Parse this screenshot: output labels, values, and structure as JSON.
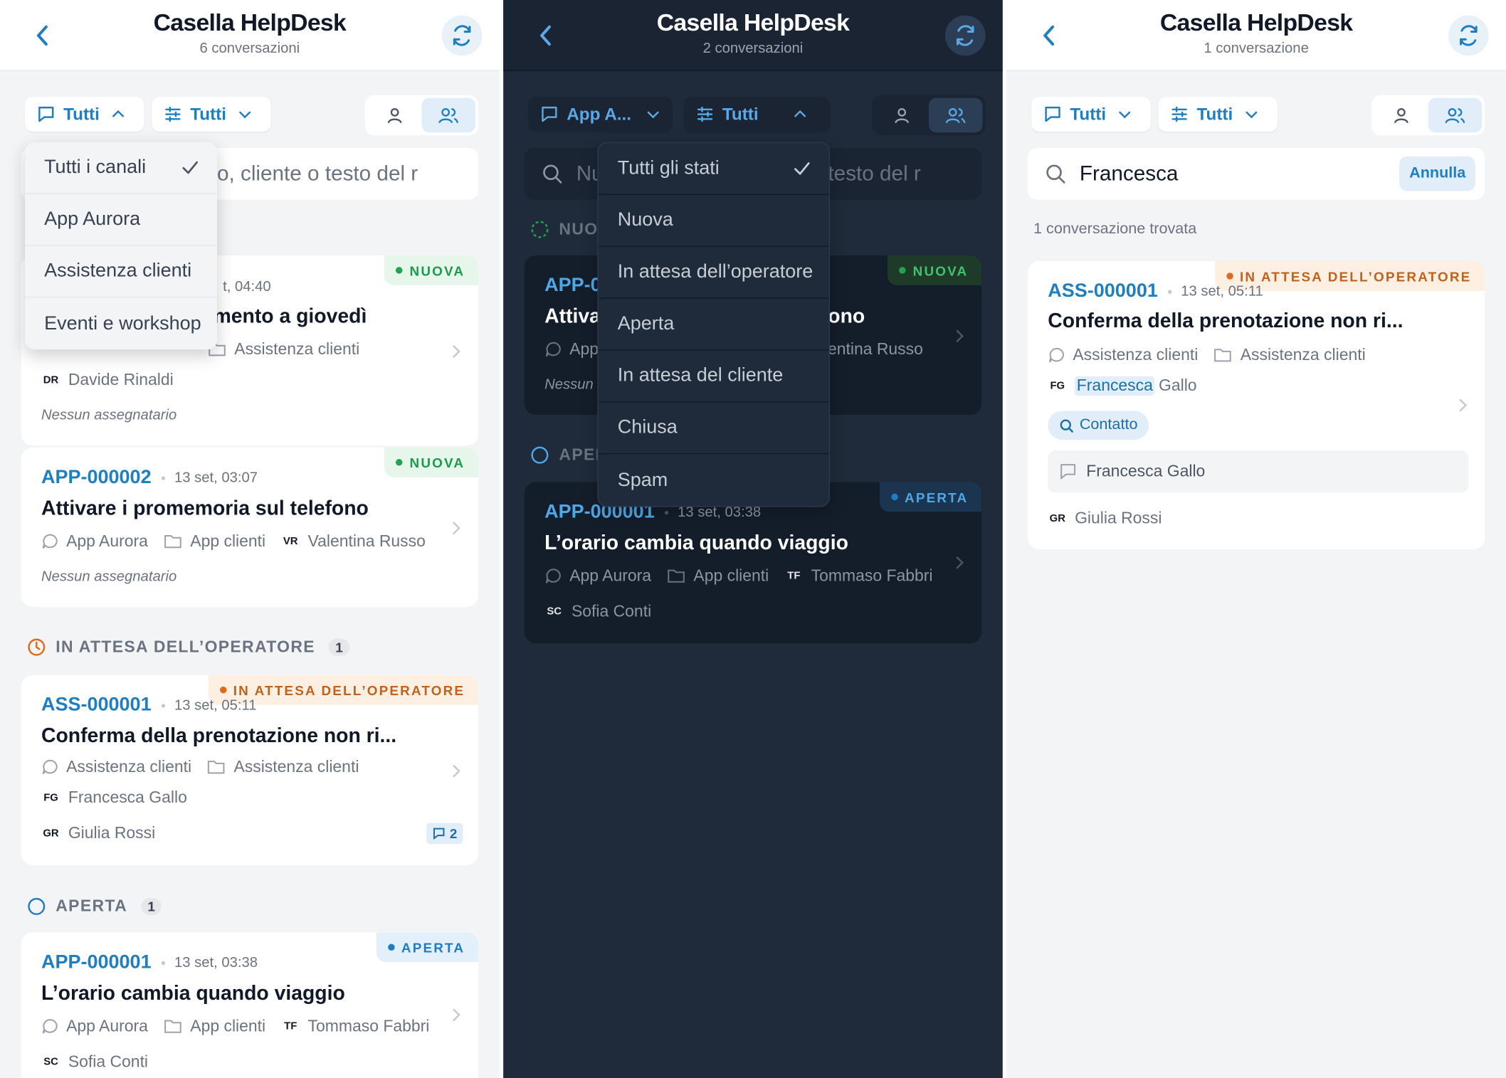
{
  "app_title": "Casella HelpDesk",
  "panel1": {
    "subtitle": "6 conversazioni",
    "channel_filter": "Tutti",
    "status_filter": "Tutti",
    "search_placeholder": "o, cliente o testo del r",
    "channel_menu": [
      "Tutti i canali",
      "App Aurora",
      "Assistenza clienti",
      "Eventi e workshop"
    ],
    "sections": {
      "waiting": {
        "label": "IN ATTESA DELL’OPERATORE",
        "count": "1"
      },
      "open": {
        "label": "APERTA",
        "count": "1"
      }
    },
    "cards": [
      {
        "badge": "NUOVA",
        "date": "t, 04:40",
        "title": "mento a giovedì",
        "channel": "Assistenza clienti",
        "queue": "Assistenza clienti",
        "customer_initials": "DR",
        "customer": "Davide Rinaldi",
        "assignee": "Nessun assegnatario"
      },
      {
        "badge": "NUOVA",
        "code": "APP-000002",
        "date": "13 set, 03:07",
        "title": "Attivare i promemoria sul telefono",
        "channel": "App Aurora",
        "queue": "App clienti",
        "customer_initials": "VR",
        "customer": "Valentina Russo",
        "assignee": "Nessun assegnatario"
      },
      {
        "badge": "IN ATTESA DELL’OPERATORE",
        "code": "ASS-000001",
        "date": "13 set, 05:11",
        "title": "Conferma della prenotazione non ri...",
        "channel": "Assistenza clienti",
        "queue": "Assistenza clienti",
        "customer_initials": "FG",
        "customer": "Francesca Gallo",
        "agent_initials": "GR",
        "agent": "Giulia Rossi",
        "messages": "2"
      },
      {
        "badge": "APERTA",
        "code": "APP-000001",
        "date": "13 set, 03:38",
        "title": "L’orario cambia quando viaggio",
        "channel": "App Aurora",
        "queue": "App clienti",
        "customer_initials": "TF",
        "customer": "Tommaso Fabbri",
        "agent_initials": "SC",
        "agent": "Sofia Conti"
      }
    ]
  },
  "panel2": {
    "subtitle": "2 conversazioni",
    "channel_filter": "App A...",
    "status_filter": "Tutti",
    "search_left": "Nu",
    "search_right": "testo del r",
    "status_menu": [
      "Tutti gli stati",
      "Nuova",
      "In attesa dell’operatore",
      "Aperta",
      "In attesa del cliente",
      "Chiusa",
      "Spam"
    ],
    "sections": {
      "new": "NUO",
      "open": "APER"
    },
    "cards": [
      {
        "badge": "NUOVA",
        "code": "APP-0",
        "title_left": "Attiva",
        "title_right": "ono",
        "channel": "App",
        "customer": "lentina Russo",
        "assignee": "Nessun"
      },
      {
        "badge": "APERTA",
        "code": "APP-000001",
        "date": "13 set, 03:38",
        "title": "L’orario cambia quando viaggio",
        "channel": "App Aurora",
        "queue": "App clienti",
        "customer_initials": "TF",
        "customer": "Tommaso Fabbri",
        "agent_initials": "SC",
        "agent": "Sofia Conti"
      }
    ]
  },
  "panel3": {
    "subtitle": "1 conversazione",
    "channel_filter": "Tutti",
    "status_filter": "Tutti",
    "search_value": "Francesca",
    "cancel": "Annulla",
    "result_count": "1 conversazione trovata",
    "card": {
      "badge": "IN ATTESA DELL’OPERATORE",
      "code": "ASS-000001",
      "date": "13 set, 05:11",
      "title": "Conferma della prenotazione non ri...",
      "channel": "Assistenza clienti",
      "queue": "Assistenza clienti",
      "customer_initials": "FG",
      "customer_first": "Francesca",
      "customer_last": "Gallo",
      "match_tag": "Contatto",
      "match_text": "Francesca Gallo",
      "agent_initials": "GR",
      "agent": "Giulia Rossi"
    }
  },
  "colors": {
    "accent": "#1d7fc1",
    "new": "#22a34f",
    "waiting": "#e06a1a",
    "open": "#1f7cc4",
    "dark_bg": "#1f2a3a"
  }
}
